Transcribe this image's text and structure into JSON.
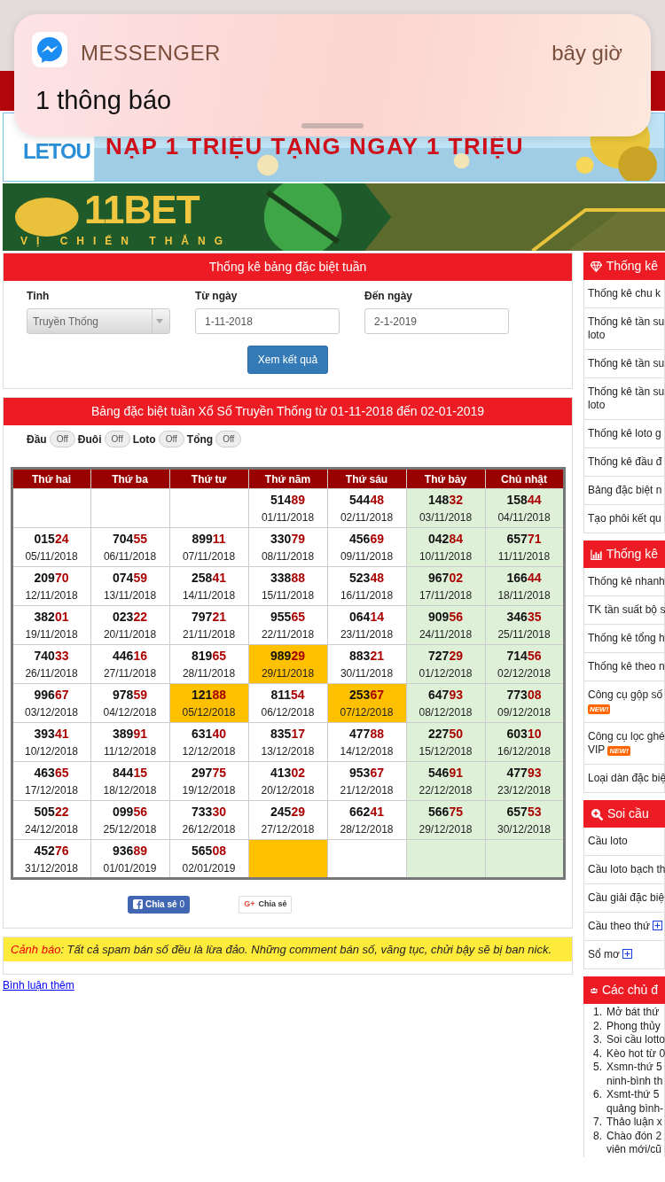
{
  "notification": {
    "app": "MESSENGER",
    "time": "bây giờ",
    "body": "1 thông báo"
  },
  "banners": [
    {
      "kind": "letou",
      "logo": "LETOU",
      "headline": "NẠP 1 TRIỆU TẠNG NGAY 1 TRIỆU"
    },
    {
      "kind": "bet",
      "logo": "11BET",
      "slogan": "VỊ CHIẾN THẮNG"
    }
  ],
  "filter": {
    "title": "Thống kê bảng đặc biệt tuần",
    "province": {
      "label": "Tỉnh",
      "value": "Truyền Thống"
    },
    "from": {
      "label": "Từ ngày",
      "value": "1-11-2018"
    },
    "to": {
      "label": "Đến ngày",
      "value": "2-1-2019"
    },
    "button": "Xem kết quả"
  },
  "results": {
    "title": "Bảng đặc biệt tuần Xổ Số Truyền Thống từ 01-11-2018 đến 02-01-2019",
    "toggles": [
      {
        "label": "Đầu",
        "state_text": "Off",
        "on": false
      },
      {
        "label": "Đuôi",
        "state_text": "Off",
        "on": false
      },
      {
        "label": "Loto",
        "state_text": "Off",
        "on": false
      },
      {
        "label": "Tổng",
        "state_text": "Off",
        "on": false
      }
    ],
    "columns": [
      {
        "label": "Thứ hai",
        "weekend": false
      },
      {
        "label": "Thứ ba",
        "weekend": false
      },
      {
        "label": "Thứ tư",
        "weekend": false
      },
      {
        "label": "Thứ năm",
        "weekend": false
      },
      {
        "label": "Thứ sáu",
        "weekend": false
      },
      {
        "label": "Thứ bảy",
        "weekend": true
      },
      {
        "label": "Chủ nhật",
        "weekend": true
      }
    ],
    "rows": [
      [
        {
          "highlighted": false
        },
        {
          "highlighted": false
        },
        {
          "highlighted": false
        },
        {
          "head": "514",
          "tail": "89",
          "date": "01/11/2018",
          "highlighted": false
        },
        {
          "head": "544",
          "tail": "48",
          "date": "02/11/2018",
          "highlighted": false
        },
        {
          "head": "148",
          "tail": "32",
          "date": "03/11/2018",
          "highlighted": false
        },
        {
          "head": "158",
          "tail": "44",
          "date": "04/11/2018",
          "highlighted": false
        }
      ],
      [
        {
          "head": "015",
          "tail": "24",
          "date": "05/11/2018",
          "highlighted": false
        },
        {
          "head": "704",
          "tail": "55",
          "date": "06/11/2018",
          "highlighted": false
        },
        {
          "head": "899",
          "tail": "11",
          "date": "07/11/2018",
          "highlighted": false
        },
        {
          "head": "330",
          "tail": "79",
          "date": "08/11/2018",
          "highlighted": false
        },
        {
          "head": "456",
          "tail": "69",
          "date": "09/11/2018",
          "highlighted": false
        },
        {
          "head": "042",
          "tail": "84",
          "date": "10/11/2018",
          "highlighted": false
        },
        {
          "head": "657",
          "tail": "71",
          "date": "11/11/2018",
          "highlighted": false
        }
      ],
      [
        {
          "head": "209",
          "tail": "70",
          "date": "12/11/2018",
          "highlighted": false
        },
        {
          "head": "074",
          "tail": "59",
          "date": "13/11/2018",
          "highlighted": false
        },
        {
          "head": "258",
          "tail": "41",
          "date": "14/11/2018",
          "highlighted": false
        },
        {
          "head": "338",
          "tail": "88",
          "date": "15/11/2018",
          "highlighted": false
        },
        {
          "head": "523",
          "tail": "48",
          "date": "16/11/2018",
          "highlighted": false
        },
        {
          "head": "967",
          "tail": "02",
          "date": "17/11/2018",
          "highlighted": false
        },
        {
          "head": "166",
          "tail": "44",
          "date": "18/11/2018",
          "highlighted": false
        }
      ],
      [
        {
          "head": "382",
          "tail": "01",
          "date": "19/11/2018",
          "highlighted": false
        },
        {
          "head": "023",
          "tail": "22",
          "date": "20/11/2018",
          "highlighted": false
        },
        {
          "head": "797",
          "tail": "21",
          "date": "21/11/2018",
          "highlighted": false
        },
        {
          "head": "955",
          "tail": "65",
          "date": "22/11/2018",
          "highlighted": false
        },
        {
          "head": "064",
          "tail": "14",
          "date": "23/11/2018",
          "highlighted": false
        },
        {
          "head": "909",
          "tail": "56",
          "date": "24/11/2018",
          "highlighted": false
        },
        {
          "head": "346",
          "tail": "35",
          "date": "25/11/2018",
          "highlighted": false
        }
      ],
      [
        {
          "head": "740",
          "tail": "33",
          "date": "26/11/2018",
          "highlighted": false
        },
        {
          "head": "446",
          "tail": "16",
          "date": "27/11/2018",
          "highlighted": false
        },
        {
          "head": "819",
          "tail": "65",
          "date": "28/11/2018",
          "highlighted": false
        },
        {
          "head": "989",
          "tail": "29",
          "date": "29/11/2018",
          "highlighted": true
        },
        {
          "head": "883",
          "tail": "21",
          "date": "30/11/2018",
          "highlighted": false
        },
        {
          "head": "727",
          "tail": "29",
          "date": "01/12/2018",
          "highlighted": false
        },
        {
          "head": "714",
          "tail": "56",
          "date": "02/12/2018",
          "highlighted": false
        }
      ],
      [
        {
          "head": "996",
          "tail": "67",
          "date": "03/12/2018",
          "highlighted": false
        },
        {
          "head": "978",
          "tail": "59",
          "date": "04/12/2018",
          "highlighted": false
        },
        {
          "head": "121",
          "tail": "88",
          "date": "05/12/2018",
          "highlighted": true
        },
        {
          "head": "811",
          "tail": "54",
          "date": "06/12/2018",
          "highlighted": false
        },
        {
          "head": "253",
          "tail": "67",
          "date": "07/12/2018",
          "highlighted": true
        },
        {
          "head": "647",
          "tail": "93",
          "date": "08/12/2018",
          "highlighted": false
        },
        {
          "head": "773",
          "tail": "08",
          "date": "09/12/2018",
          "highlighted": false
        }
      ],
      [
        {
          "head": "393",
          "tail": "41",
          "date": "10/12/2018",
          "highlighted": false
        },
        {
          "head": "389",
          "tail": "91",
          "date": "11/12/2018",
          "highlighted": false
        },
        {
          "head": "631",
          "tail": "40",
          "date": "12/12/2018",
          "highlighted": false
        },
        {
          "head": "835",
          "tail": "17",
          "date": "13/12/2018",
          "highlighted": false
        },
        {
          "head": "477",
          "tail": "88",
          "date": "14/12/2018",
          "highlighted": false
        },
        {
          "head": "227",
          "tail": "50",
          "date": "15/12/2018",
          "highlighted": false
        },
        {
          "head": "603",
          "tail": "10",
          "date": "16/12/2018",
          "highlighted": false
        }
      ],
      [
        {
          "head": "463",
          "tail": "65",
          "date": "17/12/2018",
          "highlighted": false
        },
        {
          "head": "844",
          "tail": "15",
          "date": "18/12/2018",
          "highlighted": false
        },
        {
          "head": "297",
          "tail": "75",
          "date": "19/12/2018",
          "highlighted": false
        },
        {
          "head": "413",
          "tail": "02",
          "date": "20/12/2018",
          "highlighted": false
        },
        {
          "head": "953",
          "tail": "67",
          "date": "21/12/2018",
          "highlighted": false
        },
        {
          "head": "546",
          "tail": "91",
          "date": "22/12/2018",
          "highlighted": false
        },
        {
          "head": "477",
          "tail": "93",
          "date": "23/12/2018",
          "highlighted": false
        }
      ],
      [
        {
          "head": "505",
          "tail": "22",
          "date": "24/12/2018",
          "highlighted": false
        },
        {
          "head": "099",
          "tail": "56",
          "date": "25/12/2018",
          "highlighted": false
        },
        {
          "head": "733",
          "tail": "30",
          "date": "26/12/2018",
          "highlighted": false
        },
        {
          "head": "245",
          "tail": "29",
          "date": "27/12/2018",
          "highlighted": false
        },
        {
          "head": "662",
          "tail": "41",
          "date": "28/12/2018",
          "highlighted": false
        },
        {
          "head": "566",
          "tail": "75",
          "date": "29/12/2018",
          "highlighted": false
        },
        {
          "head": "657",
          "tail": "53",
          "date": "30/12/2018",
          "highlighted": false
        }
      ],
      [
        {
          "head": "452",
          "tail": "76",
          "date": "31/12/2018",
          "highlighted": false
        },
        {
          "head": "936",
          "tail": "89",
          "date": "01/01/2019",
          "highlighted": false
        },
        {
          "head": "565",
          "tail": "08",
          "date": "02/01/2019",
          "highlighted": false
        },
        {
          "highlighted": true
        },
        {
          "highlighted": false
        },
        {
          "highlighted": false
        },
        {
          "highlighted": false
        }
      ]
    ],
    "share": {
      "facebook": "Chia sẻ",
      "facebook_count": "0",
      "google_icon": "G+",
      "google": "Chia sẻ"
    }
  },
  "warning": {
    "label": "Cảnh báo",
    "text": ": Tất cả spam bán số đều là lừa đảo. Những comment bán số, văng tục, chửi bậy sẽ bị ban nick."
  },
  "more_comments": "Bình luận thêm",
  "sidebar": [
    {
      "kind": "links",
      "title": "Thống kê",
      "items": [
        {
          "lines": [
            "Thống kê chu k"
          ]
        },
        {
          "lines": [
            "Thống kê tần su",
            "loto"
          ]
        },
        {
          "lines": [
            "Thống kê tần su"
          ]
        },
        {
          "lines": [
            "Thống kê tần su",
            "loto"
          ]
        },
        {
          "lines": [
            "Thống kê loto g"
          ]
        },
        {
          "lines": [
            "Thống kê đầu đ"
          ]
        },
        {
          "lines": [
            "Bảng đặc biệt n"
          ]
        },
        {
          "lines": [
            "Tạo phôi kết qu"
          ]
        }
      ]
    },
    {
      "kind": "links",
      "title": "Thống kê",
      "items": [
        {
          "lines": [
            "Thống kê nhanh"
          ]
        },
        {
          "lines": [
            "TK tần suất bộ s"
          ]
        },
        {
          "lines": [
            "Thống kê tổng h"
          ]
        },
        {
          "lines": [
            "Thống kê theo n"
          ]
        },
        {
          "lines": [
            "Công cụ gộp số"
          ],
          "badge": "NEW!"
        },
        {
          "lines": [
            "Công cụ lọc ghé",
            "VIP"
          ],
          "badge": "NEW!"
        },
        {
          "lines": [
            "Loại dàn đặc biệ"
          ]
        }
      ]
    },
    {
      "kind": "links",
      "title": "Soi cầu",
      "items": [
        {
          "lines": [
            "Cầu loto"
          ]
        },
        {
          "lines": [
            "Cầu loto bạch th"
          ]
        },
        {
          "lines": [
            "Cầu giải đặc biệ"
          ]
        },
        {
          "lines": [
            "Cầu theo thứ"
          ],
          "expandable": true
        },
        {
          "lines": [
            "Sổ mơ"
          ],
          "expandable": true
        }
      ]
    },
    {
      "kind": "topics",
      "title": "Các chủ đ",
      "items": [
        {
          "number": "1.",
          "lines": [
            "Mở bát thứ"
          ]
        },
        {
          "number": "2.",
          "lines": [
            "Phong thủy"
          ]
        },
        {
          "number": "3.",
          "lines": [
            "Soi cầu lotto"
          ]
        },
        {
          "number": "4.",
          "lines": [
            "Kèo hot từ 0"
          ]
        },
        {
          "number": "5.",
          "lines": [
            "Xsmn-thứ 5",
            "ninh-bình th"
          ]
        },
        {
          "number": "6.",
          "lines": [
            "Xsmt-thứ 5",
            "quảng bình-"
          ]
        },
        {
          "number": "7.",
          "lines": [
            "Thảo luận x"
          ]
        },
        {
          "number": "8.",
          "lines": [
            "Chào đón 2",
            "viên mới/cũ"
          ]
        }
      ]
    }
  ]
}
